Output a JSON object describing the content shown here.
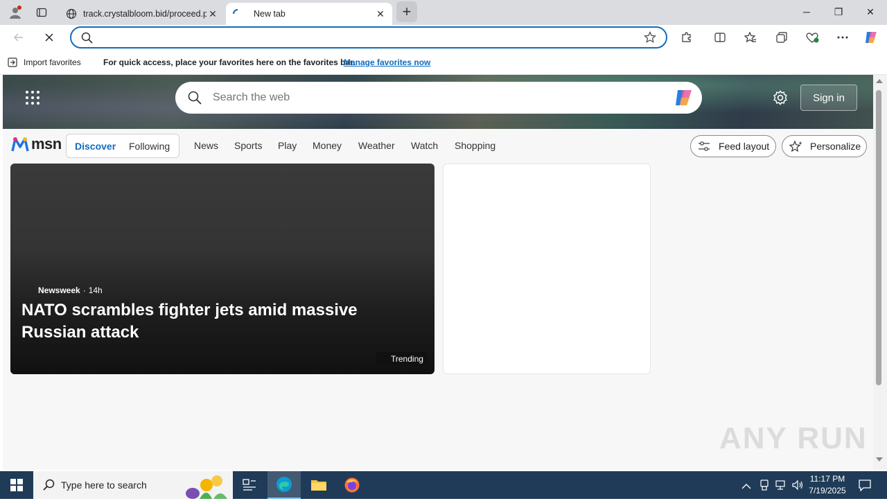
{
  "browser": {
    "tabs": [
      {
        "title": "track.crystalbloom.bid/proceed.pl",
        "close": "✕"
      },
      {
        "title": "New tab",
        "close": "✕"
      }
    ],
    "new_tab_symbol": "+",
    "window_controls": {
      "minimize": "─",
      "restore": "❐",
      "close": "✕"
    },
    "address_bar": {
      "value": "",
      "placeholder": ""
    },
    "favorites_bar": {
      "import_label": "Import favorites",
      "message": "For quick access, place your favorites here on the favorites bar.",
      "manage_link": "Manage favorites now"
    }
  },
  "msn": {
    "search_placeholder": "Search the web",
    "sign_in": "Sign in",
    "logo_text": "msn",
    "segment": [
      "Discover",
      "Following"
    ],
    "nav": [
      "News",
      "Sports",
      "Play",
      "Money",
      "Weather",
      "Watch",
      "Shopping"
    ],
    "feed_layout": "Feed layout",
    "personalize": "Personalize",
    "main_story": {
      "source": "Newsweek",
      "age": "14h",
      "separator": "·",
      "headline": "NATO scrambles fighter jets amid massive Russian attack",
      "badge": "Trending"
    }
  },
  "watermark": "ANY RUN",
  "taskbar": {
    "search_placeholder": "Type here to search",
    "time": "11:17 PM",
    "date": "7/19/2025"
  },
  "colors": {
    "accent": "#0f6cbd",
    "taskbar": "#1f3b57",
    "link": "#0f6cbd"
  }
}
